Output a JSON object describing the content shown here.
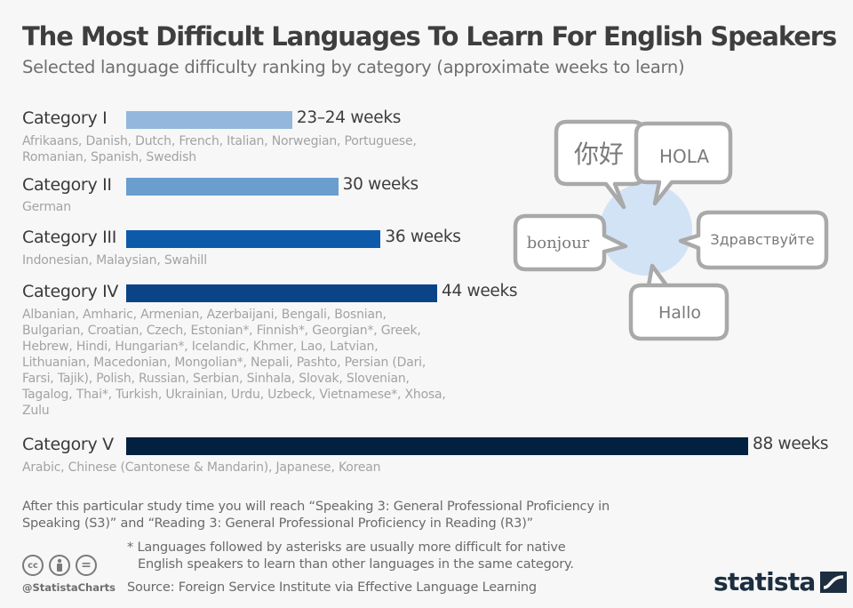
{
  "header": {
    "title": "The Most Difficult Languages To Learn For English Speakers",
    "subtitle": "Selected language difficulty ranking by category (approximate weeks to learn)"
  },
  "chart_data": {
    "type": "bar",
    "orientation": "horizontal",
    "title": "The Most Difficult Languages To Learn For English Speakers",
    "subtitle": "Selected language difficulty ranking by category (approximate weeks to learn)",
    "xlabel": "",
    "ylabel": "",
    "xlim": [
      0,
      88
    ],
    "grid": false,
    "legend": "none",
    "categories": [
      "Category I",
      "Category II",
      "Category III",
      "Category IV",
      "Category V"
    ],
    "values": [
      23.5,
      30,
      36,
      44,
      88
    ],
    "value_labels": [
      "23–24 weeks",
      "30 weeks",
      "36 weeks",
      "44 weeks",
      "88 weeks"
    ],
    "colors": [
      "#93b8dc",
      "#6a9ecf",
      "#0d5aaa",
      "#0b4387",
      "#022140"
    ],
    "languages": [
      "Afrikaans, Danish, Dutch, French, Italian, Norwegian, Portuguese, Romanian, Spanish, Swedish",
      "German",
      "Indonesian, Malaysian, Swahill",
      "Albanian, Amharic, Armenian, Azerbaijani, Bengali, Bosnian, Bulgarian, Croatian, Czech, Estonian*, Finnish*, Georgian*, Greek, Hebrew, Hindi, Hungarian*, Icelandic, Khmer, Lao, Latvian, Lithuanian, Macedonian, Mongolian*, Nepali, Pashto, Persian (Dari, Farsi, Tajik), Polish, Russian, Serbian, Sinhala, Slovak, Slovenian, Tagalog, Thai*, Turkish, Ukrainian, Urdu, Uzbeck, Vietnamese*, Xhosa, Zulu",
      "Arabic, Chinese (Cantonese & Mandarin), Japanese, Korean"
    ]
  },
  "illustration": {
    "greetings": [
      "你好",
      "HOLA",
      "bonjour",
      "Здравствуйте",
      "Hallo"
    ],
    "circle_color": "#d3e3f6",
    "bubble_border_color": "#a9a9a9"
  },
  "footer": {
    "note": "After this particular study time you will reach “Speaking 3: General Professional Proficiency in Speaking (S3)” and “Reading 3: General Professional Proficiency in Reading (R3)”",
    "asterisk_note_line1": "* Languages followed by asterisks are usually more difficult for native",
    "asterisk_note_line2": "English speakers to learn than other languages in the same category.",
    "source": "Source: Foreign Service Institute via Effective Language Learning",
    "handle": "@StatistaCharts",
    "license_icons": [
      "cc",
      "by",
      "nd"
    ],
    "cc_label": "cc",
    "nd_label": "=",
    "brand": "statista"
  }
}
